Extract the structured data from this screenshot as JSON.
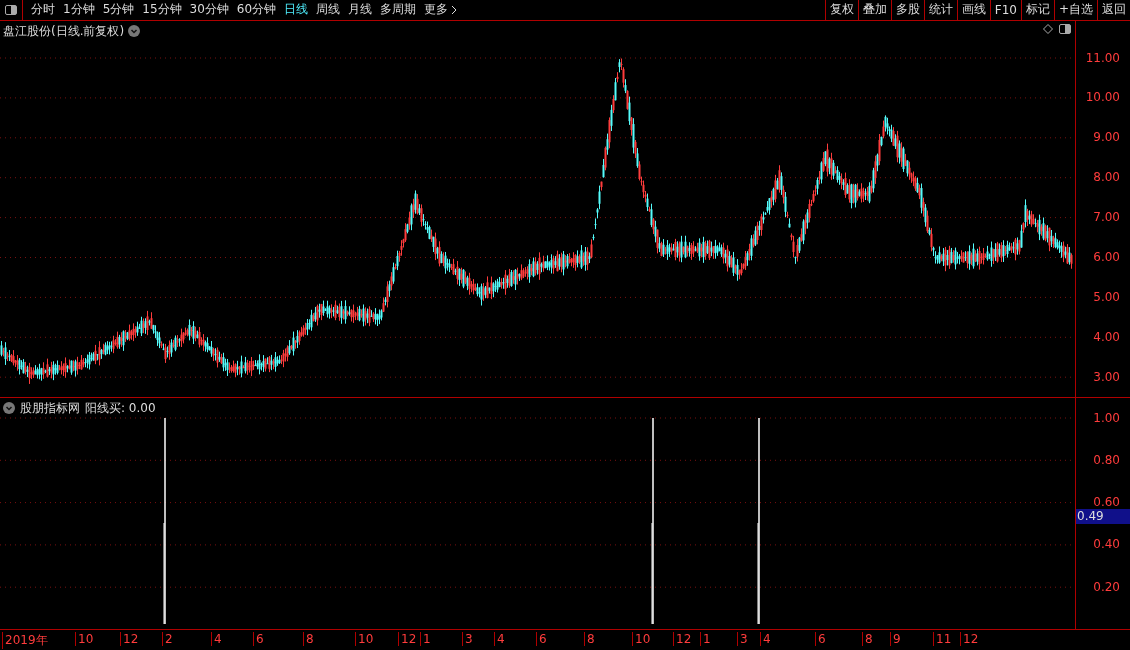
{
  "toolbar": {
    "periods": [
      {
        "label": "分时",
        "selected": false
      },
      {
        "label": "1分钟",
        "selected": false
      },
      {
        "label": "5分钟",
        "selected": false
      },
      {
        "label": "15分钟",
        "selected": false
      },
      {
        "label": "30分钟",
        "selected": false
      },
      {
        "label": "60分钟",
        "selected": false
      },
      {
        "label": "日线",
        "selected": true
      },
      {
        "label": "周线",
        "selected": false
      },
      {
        "label": "月线",
        "selected": false
      },
      {
        "label": "多周期",
        "selected": false
      },
      {
        "label": "更多",
        "selected": false
      }
    ],
    "buttons": [
      "复权",
      "叠加",
      "多股",
      "统计",
      "画线",
      "F10",
      "标记",
      "+自选",
      "返回"
    ]
  },
  "price_chart": {
    "title": "盘江股份(日线.前复权)",
    "axis_ticks": [
      "11.00",
      "10.00",
      "9.00",
      "8.00",
      "7.00",
      "6.00",
      "5.00",
      "4.00",
      "3.00"
    ]
  },
  "indicator": {
    "name": "股朋指标网",
    "reading": "阳线买: 0.00",
    "axis_ticks": [
      "1.00",
      "0.80",
      "0.60",
      "0.40",
      "0.20"
    ],
    "cursor_value": "0.49"
  },
  "date_axis": [
    "2019年",
    "10",
    "12",
    "2",
    "4",
    "6",
    "8",
    "10",
    "12",
    "1",
    "3",
    "4",
    "6",
    "8",
    "10",
    "12",
    "1",
    "3",
    "4",
    "6",
    "8",
    "9",
    "11",
    "12"
  ]
}
